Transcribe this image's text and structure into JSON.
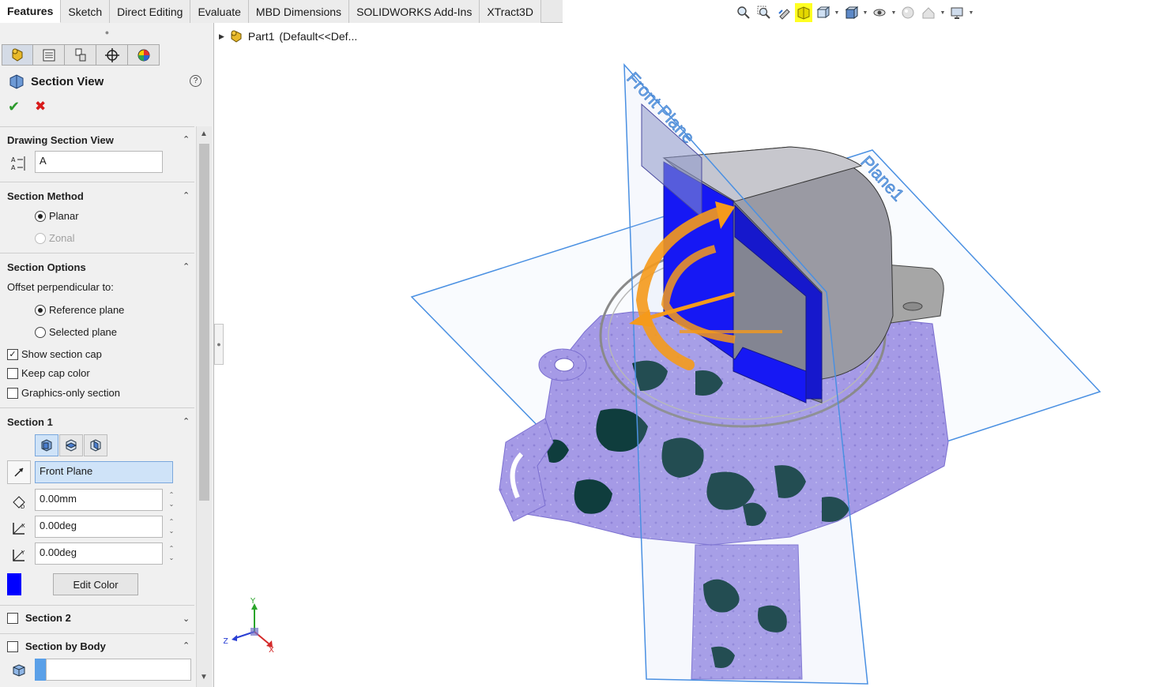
{
  "tabs": [
    "Features",
    "Sketch",
    "Direct Editing",
    "Evaluate",
    "MBD Dimensions",
    "SOLIDWORKS Add-Ins",
    "XTract3D"
  ],
  "tree": {
    "part": "Part1",
    "config": "(Default<<Def..."
  },
  "pm": {
    "title": "Section View",
    "help": "?",
    "ok_icon": "✔",
    "cancel_icon": "✖",
    "drawing_section": {
      "header": "Drawing Section View",
      "name_value": "A"
    },
    "section_method": {
      "header": "Section Method",
      "planar": "Planar",
      "zonal": "Zonal"
    },
    "section_options": {
      "header": "Section Options",
      "offset_label": "Offset perpendicular to:",
      "reference_plane": "Reference plane",
      "selected_plane": "Selected plane",
      "show_cap": "Show section cap",
      "keep_color": "Keep cap color",
      "graphics_only": "Graphics-only section"
    },
    "section1": {
      "header": "Section 1",
      "plane": "Front Plane",
      "offset": "0.00mm",
      "rot_x": "0.00deg",
      "rot_y": "0.00deg",
      "edit_color": "Edit Color",
      "cap_color": "#0000ff"
    },
    "section2": {
      "header": "Section 2"
    },
    "section_by_body": {
      "header": "Section by Body"
    }
  },
  "viewport": {
    "front_plane_label": "Front Plane",
    "plane1_label": "Plane1",
    "triad": {
      "x": "X",
      "y": "Y",
      "z": "Z"
    }
  },
  "colors": {
    "scan_mesh": "#a59ae6",
    "section_cap": "#0000f5",
    "plane": "#4a90e2",
    "arrow": "#f59a1b",
    "highlight": "#ffff22"
  }
}
